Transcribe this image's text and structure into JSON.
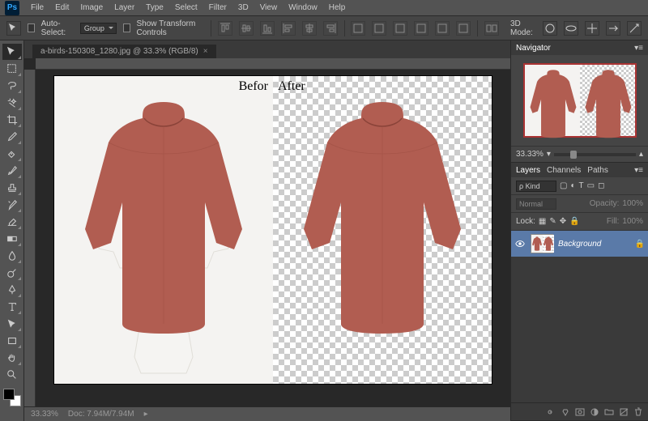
{
  "app": {
    "name": "Ps"
  },
  "menu": [
    "File",
    "Edit",
    "Image",
    "Layer",
    "Type",
    "Select",
    "Filter",
    "3D",
    "View",
    "Window",
    "Help"
  ],
  "options": {
    "autoSelect": "Auto-Select:",
    "autoSelectMode": "Group",
    "showTransform": "Show Transform Controls",
    "mode3d": "3D Mode:"
  },
  "doc": {
    "tab": "a-birds-150308_1280.jpg @ 33.3% (RGB/8)",
    "labelBefore": "Befor",
    "labelAfter": "After"
  },
  "status": {
    "zoom": "33.33%",
    "docinfo": "Doc: 7.94M/7.94M"
  },
  "panels": {
    "navigator": {
      "title": "Navigator",
      "zoom": "33.33%"
    },
    "layers": {
      "tabs": [
        "Layers",
        "Channels",
        "Paths"
      ],
      "kind": "ρ Kind",
      "blend": "Normal",
      "opacityLabel": "Opacity:",
      "opacity": "100%",
      "lockLabel": "Lock:",
      "fillLabel": "Fill:",
      "fill": "100%",
      "layerName": "Background"
    }
  },
  "tools": [
    "move",
    "marquee",
    "lasso",
    "wand",
    "crop",
    "eyedrop",
    "heal",
    "brush",
    "stamp",
    "history",
    "eraser",
    "gradient",
    "blur",
    "dodge",
    "pen",
    "type",
    "path",
    "rect",
    "hand",
    "zoom"
  ]
}
